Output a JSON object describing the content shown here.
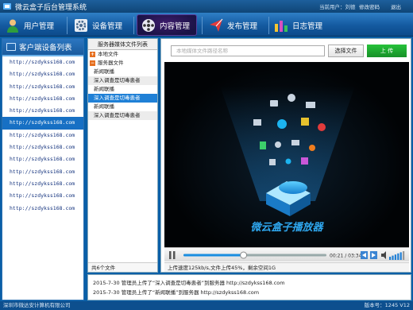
{
  "window": {
    "title": "微云盒子后台管理系统"
  },
  "topbar": {
    "user_text": "当前用户：刘德",
    "change_password": "修改密码",
    "logout": "退出"
  },
  "nav": {
    "tabs": [
      {
        "label": "用户管理",
        "icon": "user-icon"
      },
      {
        "label": "设备管理",
        "icon": "gear-icon"
      },
      {
        "label": "内容管理",
        "icon": "film-reel-icon",
        "active": true
      },
      {
        "label": "发布管理",
        "icon": "send-icon"
      },
      {
        "label": "日志管理",
        "icon": "bar-chart-icon"
      }
    ]
  },
  "devices": {
    "title": "客户端设备列表",
    "items": [
      "http://szdykss168.com",
      "http://szdykss168.com",
      "http://szdykss168.com",
      "http://szdykss168.com",
      "http://szdykss168.com",
      "http://szdykss168.com",
      "http://szdykss168.com",
      "http://szdykss168.com",
      "http://szdykss168.com",
      "http://szdykss168.com",
      "http://szdykss168.com",
      "http://szdykss168.com",
      "http://szdykss168.com"
    ],
    "selected_index": 5
  },
  "media": {
    "title": "服务器媒体文件列表",
    "local_group": "本地文件",
    "server_group": "服务器文件",
    "files": [
      "新闻联播",
      "深入调查是切毒患者",
      "新闻联播",
      "深入调查是切毒患者",
      "新闻联播",
      "深入调查是切毒患者"
    ],
    "selected_index": 3,
    "footer": "共6个文件"
  },
  "upload": {
    "placeholder": "本地媒体文件路径名称",
    "choose_button": "选择文件",
    "upload_button": "上 传"
  },
  "player": {
    "brand": "微云盒子播放器",
    "time": "00:21 / 03:34",
    "progress": 0.42,
    "volume": 0.8,
    "status": "上传速度125kb/s,文件上传45%，剩余空间1G"
  },
  "log": {
    "lines": [
      "2015-7-30 管理员上传了“深入调查是切毒患者”到服务器 http://szdykss168.com",
      "2015-7-30 管理员上传了“新闻联播”到服务器 http://szdykss168.com"
    ]
  },
  "footer": {
    "company": "深圳市微达安计算机有限公司",
    "version": "版本号：1245 V12"
  },
  "colors": {
    "accent": "#1770c4",
    "upload_green": "#1fa52f",
    "group_orange": "#e66f1f"
  }
}
